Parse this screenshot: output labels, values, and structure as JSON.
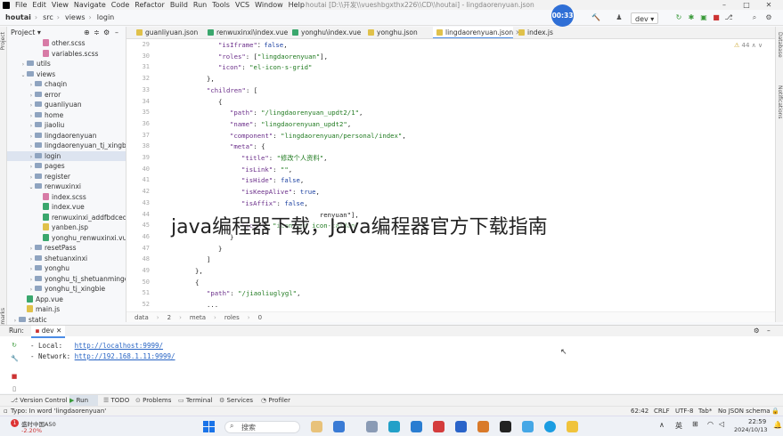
{
  "menu": {
    "items": [
      "File",
      "Edit",
      "View",
      "Navigate",
      "Code",
      "Refactor",
      "Build",
      "Run",
      "Tools",
      "VCS",
      "Window",
      "Help"
    ],
    "window_title": "houtai [D:\\\\开发\\\\vueshbgxthx226\\\\CD\\\\houtai] - lingdaorenyuan.json"
  },
  "nav": {
    "crumbs": [
      "houtai",
      "src",
      "views",
      "login"
    ],
    "run_config": "dev",
    "clock": "00:33"
  },
  "project": {
    "title": "Project",
    "tree": [
      {
        "label": "other.scss",
        "type": "scss",
        "depth": 4,
        "arrow": ""
      },
      {
        "label": "variables.scss",
        "type": "scss",
        "depth": 4,
        "arrow": ""
      },
      {
        "label": "utils",
        "type": "folder",
        "depth": 2,
        "arrow": "›"
      },
      {
        "label": "views",
        "type": "folder",
        "depth": 2,
        "arrow": "⌄"
      },
      {
        "label": "chaqin",
        "type": "folder",
        "depth": 3,
        "arrow": "›"
      },
      {
        "label": "error",
        "type": "folder",
        "depth": 3,
        "arrow": "›"
      },
      {
        "label": "guanliyuan",
        "type": "folder",
        "depth": 3,
        "arrow": "›"
      },
      {
        "label": "home",
        "type": "folder",
        "depth": 3,
        "arrow": "›"
      },
      {
        "label": "jiaoliu",
        "type": "folder",
        "depth": 3,
        "arrow": "›"
      },
      {
        "label": "lingdaorenyuan",
        "type": "folder",
        "depth": 3,
        "arrow": "›"
      },
      {
        "label": "lingdaorenyuan_tj_xingbie",
        "type": "folder",
        "depth": 3,
        "arrow": "›"
      },
      {
        "label": "login",
        "type": "folder",
        "depth": 3,
        "arrow": "›",
        "selected": true
      },
      {
        "label": "pages",
        "type": "folder",
        "depth": 3,
        "arrow": "›"
      },
      {
        "label": "register",
        "type": "folder",
        "depth": 3,
        "arrow": "›"
      },
      {
        "label": "renwuxinxi",
        "type": "folder",
        "depth": 3,
        "arrow": "⌄"
      },
      {
        "label": "index.scss",
        "type": "scss",
        "depth": 4,
        "arrow": ""
      },
      {
        "label": "index.vue",
        "type": "vue",
        "depth": 4,
        "arrow": ""
      },
      {
        "label": "renwuxinxi_addfbdcedb",
        "type": "vue",
        "depth": 4,
        "arrow": ""
      },
      {
        "label": "yanben.jsp",
        "type": "js",
        "depth": 4,
        "arrow": ""
      },
      {
        "label": "yonghu_renwuxinxi.vue",
        "type": "vue",
        "depth": 4,
        "arrow": ""
      },
      {
        "label": "resetPass",
        "type": "folder",
        "depth": 3,
        "arrow": "›"
      },
      {
        "label": "shetuanxinxi",
        "type": "folder",
        "depth": 3,
        "arrow": "›"
      },
      {
        "label": "yonghu",
        "type": "folder",
        "depth": 3,
        "arrow": "›"
      },
      {
        "label": "yonghu_tj_shetuanmingcheng",
        "type": "folder",
        "depth": 3,
        "arrow": "›"
      },
      {
        "label": "yonghu_tj_xingbie",
        "type": "folder",
        "depth": 3,
        "arrow": "›"
      },
      {
        "label": "App.vue",
        "type": "vue",
        "depth": 2,
        "arrow": ""
      },
      {
        "label": "main.js",
        "type": "js",
        "depth": 2,
        "arrow": ""
      },
      {
        "label": "static",
        "type": "folder",
        "depth": 1,
        "arrow": "›"
      }
    ]
  },
  "tabs": [
    {
      "label": "guanliyuan.json",
      "type": "js",
      "active": false
    },
    {
      "label": "renwuxinxi\\index.vue",
      "type": "vue",
      "active": false
    },
    {
      "label": "yonghu\\index.vue",
      "type": "vue",
      "active": false
    },
    {
      "label": "yonghu.json",
      "type": "js",
      "active": false
    },
    {
      "label": "lingdaorenyuan.json",
      "type": "js",
      "active": true
    },
    {
      "label": "index.js",
      "type": "js",
      "active": false
    }
  ],
  "editor": {
    "inspection": "44",
    "lines": [
      {
        "n": "29",
        "indent": 5,
        "parts": [
          [
            "k",
            "\"isIframe\""
          ],
          [
            "",
            "："
          ],
          [
            "b",
            "false"
          ],
          [
            "",
            ","
          ]
        ]
      },
      {
        "n": "30",
        "indent": 5,
        "parts": [
          [
            "k",
            "\"roles\""
          ],
          [
            "",
            ": ["
          ],
          [
            "s",
            "\"lingdaorenyuan\""
          ],
          [
            "",
            "],"
          ]
        ]
      },
      {
        "n": "31",
        "indent": 5,
        "parts": [
          [
            "k",
            "\"icon\""
          ],
          [
            "",
            ": "
          ],
          [
            "s",
            "\"el-icon-s-grid\""
          ]
        ]
      },
      {
        "n": "32",
        "indent": 4,
        "parts": [
          [
            "",
            "},"
          ]
        ]
      },
      {
        "n": "33",
        "indent": 4,
        "parts": [
          [
            "k",
            "\"children\""
          ],
          [
            "",
            ": ["
          ]
        ]
      },
      {
        "n": "34",
        "indent": 5,
        "parts": [
          [
            "",
            "{"
          ]
        ]
      },
      {
        "n": "35",
        "indent": 6,
        "parts": [
          [
            "k",
            "\"path\""
          ],
          [
            "",
            ": "
          ],
          [
            "s",
            "\"/lingdaorenyuan_updt2/1\""
          ],
          [
            "",
            ","
          ]
        ]
      },
      {
        "n": "36",
        "indent": 6,
        "parts": [
          [
            "k",
            "\"name\""
          ],
          [
            "",
            ": "
          ],
          [
            "s",
            "\"lingdaorenyuan_updt2\""
          ],
          [
            "",
            ","
          ]
        ]
      },
      {
        "n": "37",
        "indent": 6,
        "parts": [
          [
            "k",
            "\"component\""
          ],
          [
            "",
            ": "
          ],
          [
            "s",
            "\"lingdaorenyuan/personal/index\""
          ],
          [
            "",
            ","
          ]
        ]
      },
      {
        "n": "38",
        "indent": 6,
        "parts": [
          [
            "k",
            "\"meta\""
          ],
          [
            "",
            ": {"
          ]
        ]
      },
      {
        "n": "39",
        "indent": 7,
        "parts": [
          [
            "k",
            "\"title\""
          ],
          [
            "",
            ": "
          ],
          [
            "s",
            "\"修改个人资料\""
          ],
          [
            "",
            ","
          ]
        ]
      },
      {
        "n": "40",
        "indent": 7,
        "parts": [
          [
            "k",
            "\"isLink\""
          ],
          [
            "",
            ": "
          ],
          [
            "s",
            "\"\""
          ],
          [
            "",
            ","
          ]
        ]
      },
      {
        "n": "41",
        "indent": 7,
        "parts": [
          [
            "k",
            "\"isHide\""
          ],
          [
            "",
            ": "
          ],
          [
            "b",
            "false"
          ],
          [
            "",
            ","
          ]
        ]
      },
      {
        "n": "42",
        "indent": 7,
        "parts": [
          [
            "k",
            "\"isKeepAlive\""
          ],
          [
            "",
            ": "
          ],
          [
            "b",
            "true"
          ],
          [
            "",
            ","
          ]
        ]
      },
      {
        "n": "43",
        "indent": 7,
        "parts": [
          [
            "k",
            "\"isAffix\""
          ],
          [
            "",
            ": "
          ],
          [
            "b",
            "false"
          ],
          [
            "",
            ","
          ]
        ]
      },
      {
        "n": "44",
        "indent": 7,
        "parts": [
          [
            "",
            "                    renyuan\"],"
          ]
        ]
      },
      {
        "n": "45",
        "indent": 7,
        "parts": [
          [
            "k",
            "\"icon\""
          ],
          [
            "",
            ": "
          ],
          [
            "s",
            "\"iconfont icon-caidan\""
          ]
        ]
      },
      {
        "n": "46",
        "indent": 6,
        "parts": [
          [
            "",
            "}"
          ]
        ]
      },
      {
        "n": "47",
        "indent": 5,
        "parts": [
          [
            "",
            "}"
          ]
        ]
      },
      {
        "n": "48",
        "indent": 4,
        "parts": [
          [
            "",
            "]"
          ]
        ]
      },
      {
        "n": "49",
        "indent": 3,
        "parts": [
          [
            "",
            "},"
          ]
        ]
      },
      {
        "n": "50",
        "indent": 3,
        "parts": [
          [
            "",
            "{"
          ]
        ]
      },
      {
        "n": "51",
        "indent": 4,
        "parts": [
          [
            "k",
            "\"path\""
          ],
          [
            "",
            ": "
          ],
          [
            "s",
            "\"/jiaoliuglygl\""
          ],
          [
            "",
            ","
          ]
        ]
      },
      {
        "n": "52",
        "indent": 4,
        "parts": [
          [
            "",
            "..."
          ]
        ]
      }
    ],
    "breadcrumbs": [
      "data",
      "2",
      "meta",
      "roles",
      "0"
    ]
  },
  "watermark": "java编程器下载，Java编程器官方下载指南",
  "run": {
    "label": "Run:",
    "config": "dev",
    "local_label": "- Local:",
    "local_url": "http://localhost:9999/",
    "network_label": "- Network:",
    "network_url": "http://192.168.1.11:9999/"
  },
  "tool_windows": [
    "Version Control",
    "Run",
    "TODO",
    "Problems",
    "Terminal",
    "Services",
    "Profiler"
  ],
  "status": {
    "message": "Typo: In word 'lingdaorenyuan'",
    "position": "62:42",
    "line_sep": "CRLF",
    "encoding": "UTF-8",
    "indent": "Tab*",
    "schema": "No JSON schema"
  },
  "taskbar": {
    "weather_title": "盛时中国A50",
    "weather_change": "-2.20%",
    "search": "搜索",
    "lang": "英",
    "time": "22:59",
    "date": "2024/10/13",
    "badge": "1"
  },
  "colors": {
    "accent": "#4b8ce6",
    "selected": "#dde4f0",
    "keyword": "#6b2f8a",
    "string": "#1f7a1f",
    "literal": "#1a3fa0",
    "link": "#2764c4"
  }
}
